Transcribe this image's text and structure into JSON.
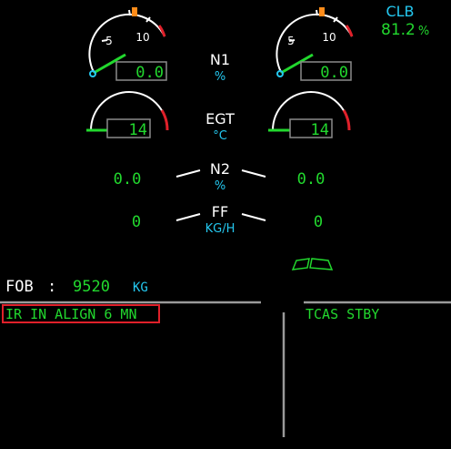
{
  "colors": {
    "background": "#000000",
    "white": "#ffffff",
    "green": "#22d82e",
    "cyan": "#24c8f0",
    "red": "#e0202a",
    "amber": "#ff8c1a",
    "memo_highlight": "#e0202a"
  },
  "thrust": {
    "mode": "CLB",
    "limit": "81.2",
    "limit_unit": "%"
  },
  "n1": {
    "label": "N1",
    "unit": "%",
    "scale_labels": [
      "5",
      "10"
    ],
    "left_value": "0.0",
    "right_value": "0.0"
  },
  "egt": {
    "label": "EGT",
    "unit": "°C",
    "left_value": "14",
    "right_value": "14"
  },
  "n2": {
    "label": "N2",
    "unit": "%",
    "left_value": "0.0",
    "right_value": "0.0"
  },
  "ff": {
    "label": "FF",
    "unit": "KG/H",
    "left_value": "0",
    "right_value": "0"
  },
  "fob": {
    "label": "FOB",
    "separator": ":",
    "value": "9520",
    "unit": "KG"
  },
  "flaps": {
    "icon": "flap-indicator-icon"
  },
  "memo": {
    "left_message": "IR IN ALIGN 6 MN",
    "right_message": "TCAS STBY"
  }
}
